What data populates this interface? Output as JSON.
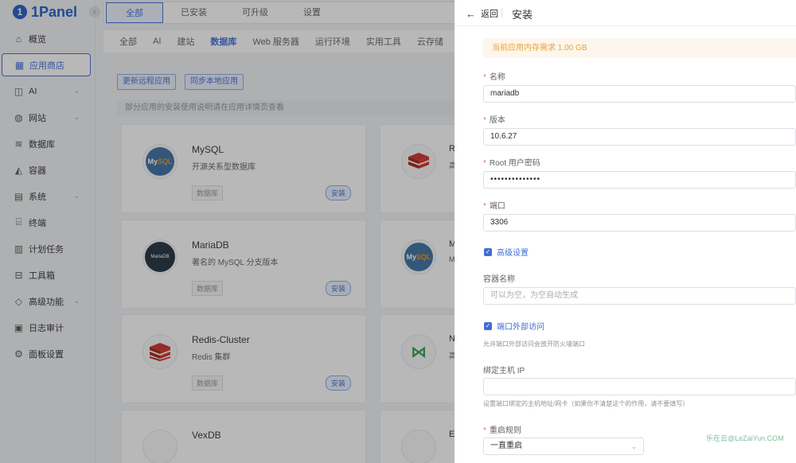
{
  "app": {
    "logo_text": "1Panel",
    "logo_mark": "1",
    "collapse_icon": "chevron-left-icon"
  },
  "sidebar": {
    "items": [
      {
        "label": "概览",
        "icon": "home-icon",
        "glyph": "⌂",
        "chevron": ""
      },
      {
        "label": "应用商店",
        "icon": "grid-icon",
        "glyph": "▦",
        "chevron": "",
        "active": true
      },
      {
        "label": "AI",
        "icon": "robot-icon",
        "glyph": "◫",
        "chevron": "⌄"
      },
      {
        "label": "网站",
        "icon": "globe-icon",
        "glyph": "◍",
        "chevron": "⌄"
      },
      {
        "label": "数据库",
        "icon": "database-icon",
        "glyph": "≋",
        "chevron": ""
      },
      {
        "label": "容器",
        "icon": "container-icon",
        "glyph": "◭",
        "chevron": ""
      },
      {
        "label": "系统",
        "icon": "system-icon",
        "glyph": "▤",
        "chevron": "⌄"
      },
      {
        "label": "终端",
        "icon": "terminal-icon",
        "glyph": "⌸",
        "chevron": ""
      },
      {
        "label": "计划任务",
        "icon": "calendar-icon",
        "glyph": "▥",
        "chevron": ""
      },
      {
        "label": "工具箱",
        "icon": "toolbox-icon",
        "glyph": "⊟",
        "chevron": ""
      },
      {
        "label": "高级功能",
        "icon": "diamond-icon",
        "glyph": "◇",
        "chevron": "⌄"
      },
      {
        "label": "日志审计",
        "icon": "log-icon",
        "glyph": "▣",
        "chevron": ""
      },
      {
        "label": "面板设置",
        "icon": "settings-icon",
        "glyph": "⚙",
        "chevron": ""
      }
    ]
  },
  "top_tabs": [
    "全部",
    "已安装",
    "可升级",
    "设置"
  ],
  "categories": [
    "全部",
    "AI",
    "建站",
    "数据库",
    "Web 服务器",
    "运行环境",
    "实用工具",
    "云存储"
  ],
  "actions": {
    "update_remote": "更新远程应用",
    "sync_local": "同步本地应用"
  },
  "notice": "部分应用的安装使用说明请在应用详情页查看",
  "cards": [
    {
      "name": "MySQL",
      "desc": "开源关系型数据库",
      "tag": "数据库",
      "install": "安装"
    },
    {
      "name": "MariaDB",
      "desc": "著名的 MySQL 分支版本",
      "tag": "数据库",
      "install": "安装"
    },
    {
      "name": "Redis-Cluster",
      "desc": "Redis 集群",
      "tag": "数据库",
      "install": "安装"
    },
    {
      "name": "VexDB",
      "desc": "",
      "tag": "",
      "install": ""
    }
  ],
  "peek_cards": [
    {
      "name": "R",
      "desc": "高"
    },
    {
      "name": "M",
      "desc": "M"
    },
    {
      "name": "N",
      "desc": "高"
    },
    {
      "name": "E",
      "desc": ""
    }
  ],
  "logos": {
    "mysql": "My",
    "mysql_accent": "SQL",
    "mariadb": "MariaDB"
  },
  "drawer": {
    "back_label": "返回",
    "title": "安装",
    "memory_alert": "当前应用内存需求 1.00 GB",
    "fields": {
      "name": {
        "label": "名称",
        "value": "mariadb"
      },
      "version": {
        "label": "版本",
        "value": "10.6.27"
      },
      "root_password": {
        "label": "Root 用户密码",
        "value": "••••••••••••••"
      },
      "port": {
        "label": "端口",
        "value": "3306"
      },
      "advanced": {
        "label": "高级设置"
      },
      "container_name": {
        "label": "容器名称",
        "placeholder": "可以为空，为空自动生成"
      },
      "external_access": {
        "label": "端口外部访问",
        "hint": "允许端口外部访问会放开防火墙端口"
      },
      "bind_ip": {
        "label": "绑定主机 IP",
        "value": "",
        "hint": "设置端口绑定的主机地址/网卡（如果你不清楚这个的作用，请不要填写）"
      },
      "restart_policy": {
        "label": "重启规则",
        "value": "一直重启"
      }
    }
  },
  "watermark": "乐在云@LeZaiYun.COM",
  "colors": {
    "accent": "#3e6dd8",
    "warning_bg": "#fdf6ec",
    "warning_text": "#e6a23c",
    "required": "#f56c6c"
  }
}
